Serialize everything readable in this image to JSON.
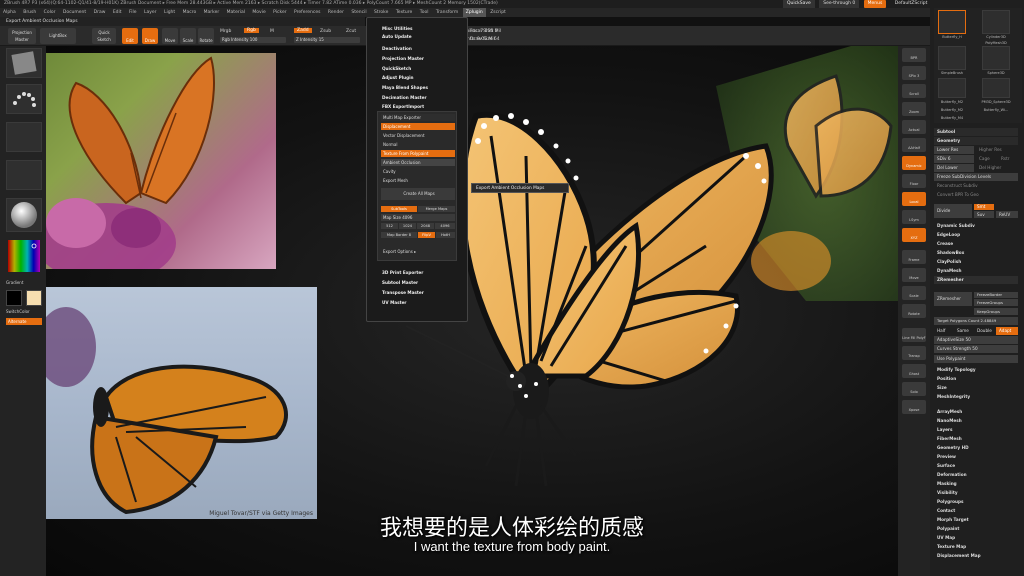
{
  "app": {
    "title_bar": "ZBrush 4R7 P3 (x64)(Q:64-1102-Q1/41-8/19-H01K)   ZBrush Document   ▸ Free Mem 28.443GB ▸ Active Mem 2163 ▸ Scratch Disk 5444 ▸ Timer 7.82 ATime 0.036 ▸ PolyCount 7.665 MP ▸ MeshCount 2   Memory 1502(CTrade)"
  },
  "top_right": {
    "quicksave": "QuickSave",
    "see_through": "See-through  0",
    "menus": "Menus",
    "default_script": "DefaultZScript"
  },
  "menu_bar": {
    "items": [
      "Alpha",
      "Brush",
      "Color",
      "Document",
      "Draw",
      "Edit",
      "File",
      "Layer",
      "Light",
      "Macro",
      "Marker",
      "Material",
      "Movie",
      "Picker",
      "Preferences",
      "Render",
      "Stencil",
      "Stroke",
      "Texture",
      "Tool",
      "Transform",
      "Zplugin",
      "Zscript"
    ],
    "active": "Zplugin"
  },
  "sub_bar": {
    "title": "Export Ambient Occlusion Maps"
  },
  "toolbar": {
    "projection_master": "Projection Master",
    "lightbox": "LightBox",
    "quick_sketch": "Quick Sketch",
    "edit": "Edit",
    "draw": "Draw",
    "move": "Move",
    "scale": "Scale",
    "rotate": "Rotate",
    "mrgb": "Mrgb",
    "rgb": "Rgb",
    "m": "M",
    "rgb_intensity": "Rgb Intensity 100",
    "zadd": "Zadd",
    "zsub": "Zsub",
    "z_intensity": "Z Intensity 15",
    "focal_shift": "Focal Shift 0",
    "draw_size": "Draw Size 64",
    "dynamic": "Dynamic",
    "active_points": "ActivePoints: 7.656 Mil",
    "total_points": "TotalPoints: 9.05 Mil"
  },
  "plugin_menu": {
    "items": [
      "Misc Utilities",
      "Auto Update",
      "Deactivation",
      "Projection Master",
      "QuickSketch",
      "Adjust Plugin",
      "Maya Blend Shapes",
      "Decimation Master",
      "FBX ExportImport"
    ],
    "bottom_items": [
      "3D Print Exporter",
      "Subtool Master",
      "Transpose Master",
      "UV Master"
    ],
    "msm": {
      "title": "Multi Map Exporter",
      "displacement": "Displacement",
      "vector_displacement": "Vector Displacement",
      "normal": "Normal",
      "texture_from_polypaint": "Texture From Polypaint",
      "ambient_occlusion": "Ambient Occlusion",
      "cavity": "Cavity",
      "export_mesh": "Export Mesh",
      "create_all_maps": "Create All Maps",
      "subtools": "SubTools",
      "merge_maps": "Merge Maps",
      "map_size": "Map Size 4096",
      "sizes": [
        "512",
        "1024",
        "2048",
        "4096"
      ],
      "map_border": "Map Border 8",
      "flip_v": "FlipV",
      "hoth": "HotH",
      "export_options": "Export Options ▸"
    }
  },
  "tooltip": {
    "text": "Export Ambient Occlusion Maps"
  },
  "left_shelf": {
    "gradient": "Gradient",
    "switch_color": "SwitchColor",
    "alternate": "Alternate"
  },
  "photo_credit": "Miguel Tovar/STF via Getty Images",
  "right_shelf": {
    "buttons": [
      "BPR",
      "SPix 3",
      "Scroll",
      "Zoom",
      "Actual",
      "AAHalf",
      "Dynamic Persp",
      "Floor",
      "Local",
      "LSym",
      "XYZ",
      "Frame",
      "Move",
      "Scale",
      "Rotate",
      "Line Fill PolyF",
      "Transp",
      "Ghost",
      "Solo",
      "Xpose"
    ]
  },
  "right_tray": {
    "thumbs": [
      "Butterfly_H",
      "Cylinder3D",
      "PolyMesh3D",
      "SimpleBrush",
      "Sphere3D",
      "Butterfly_M2",
      "PM3D_Sphere3D",
      "Butterfly_M2",
      "Butterfly_Wi...",
      "Butterfly_M4"
    ],
    "subtool_header": "Subtool",
    "geometry_header": "Geometry",
    "lower_res": "Lower Res",
    "higher_res": "Higher Res",
    "sdiv": "SDiv 6",
    "cage": "Cage",
    "rstr": "Rstr",
    "del_lower": "Del Lower",
    "del_higher": "Del Higher",
    "freeze_subdivision": "Freeze SubDivision Levels",
    "reconstruct_subdiv": "Reconstruct Subdiv",
    "convert_bpr": "Convert BPR To Geo",
    "divide": "Divide",
    "smt": "Smt",
    "suv": "Suv",
    "reuv": "ReUV",
    "items_a": [
      "Dynamic Subdiv",
      "EdgeLoop",
      "Crease",
      "ShadowBox",
      "ClayPolish",
      "DynaMesh",
      "ZRemesher"
    ],
    "zremesher": "ZRemesher",
    "freeze_border": "FreezeBorder",
    "freeze_groups": "FreezeGroups",
    "keep_groups": "KeepGroups",
    "target_polygons": "Target Polygons Count 2.48849",
    "half": "Half",
    "same": "Same",
    "double": "Double",
    "adapt": "Adapt",
    "adaptive_size": "AdaptiveSize 50",
    "curves_strength": "Curves Strength 50",
    "use_polypaint": "Use Polypaint",
    "items_b": [
      "Modify Topology",
      "Position",
      "Size",
      "MeshIntegrity"
    ],
    "items_c": [
      "ArrayMesh",
      "NanoMesh",
      "Layers",
      "FiberMesh",
      "Geometry HD",
      "Preview",
      "Surface",
      "Deformation",
      "Masking",
      "Visibility",
      "Polygroups",
      "Contact",
      "Morph Target",
      "Polypaint",
      "UV Map",
      "Texture Map",
      "Displacement Map"
    ]
  },
  "subtitles": {
    "zh": "我想要的是人体彩绘的质感",
    "en": "I want the texture from body paint."
  },
  "colors": {
    "accent": "#e56d10",
    "panel": "#2b2b2b",
    "background": "#111111"
  }
}
